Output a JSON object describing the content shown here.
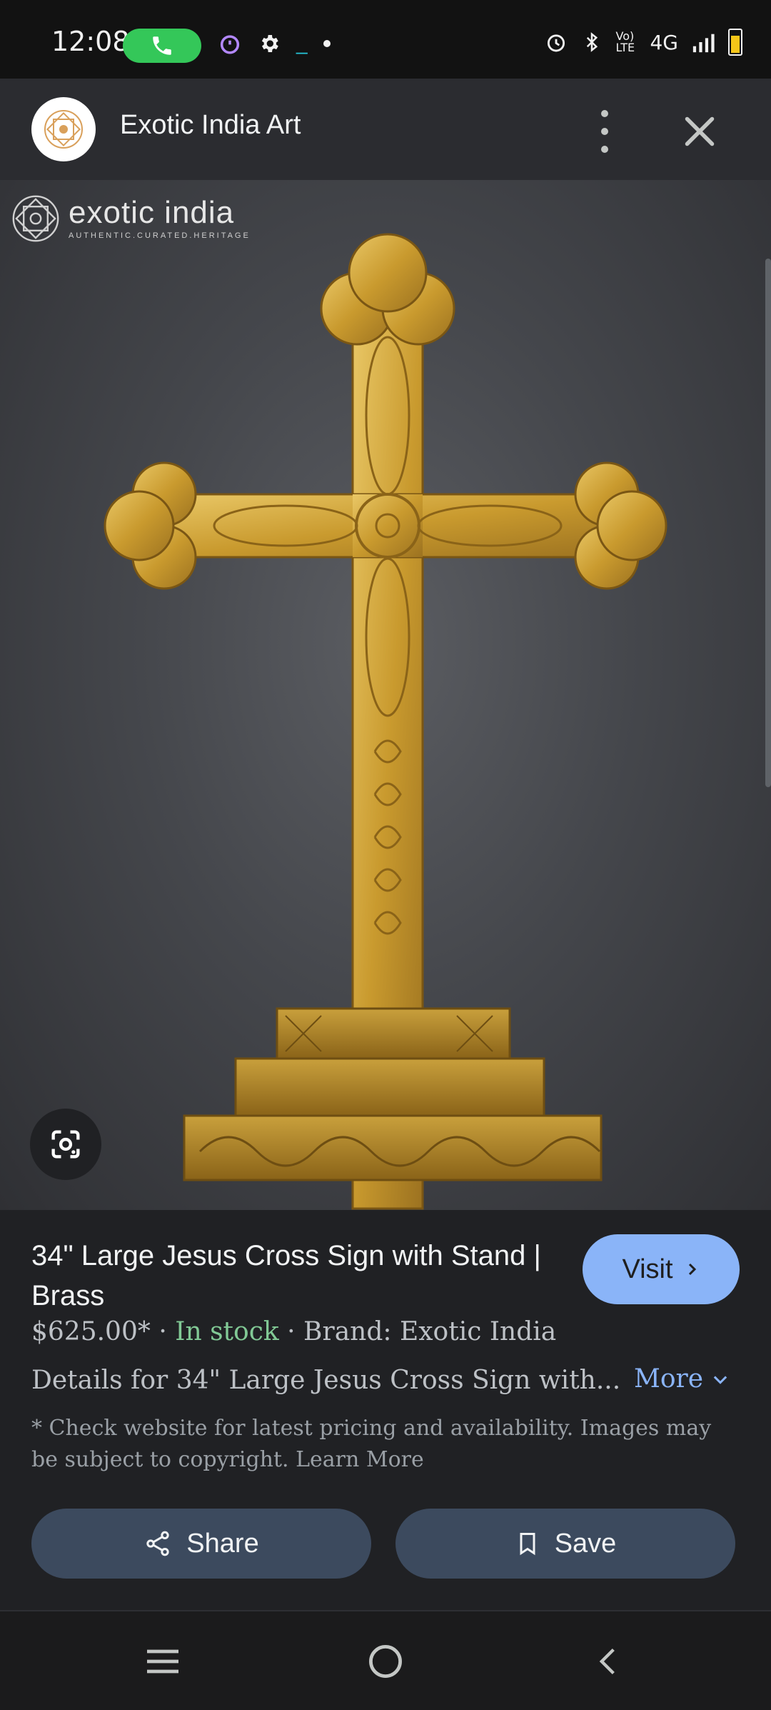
{
  "status_bar": {
    "time": "12:08",
    "network": "4G",
    "volte": "Vo) LTE"
  },
  "header": {
    "site_name": "Exotic India Art"
  },
  "image": {
    "watermark_text": "exotic india",
    "watermark_sub": "AUTHENTIC.CURATED.HERITAGE"
  },
  "product": {
    "title": "34\" Large Jesus Cross Sign with Stand | Brass",
    "price": "$625.00*",
    "separator": "·",
    "stock": "In stock",
    "brand": "Brand: Exotic India",
    "details": "Details for 34\" Large Jesus Cross Sign with...",
    "more_label": "More",
    "disclaimer": "* Check website for latest pricing and availability. Images may be subject to copyright. Learn More"
  },
  "buttons": {
    "visit": "Visit",
    "share": "Share",
    "save": "Save"
  },
  "colors": {
    "accent": "#8ab4f8",
    "in_stock": "#81c995",
    "action_button": "#3c4a5e"
  }
}
